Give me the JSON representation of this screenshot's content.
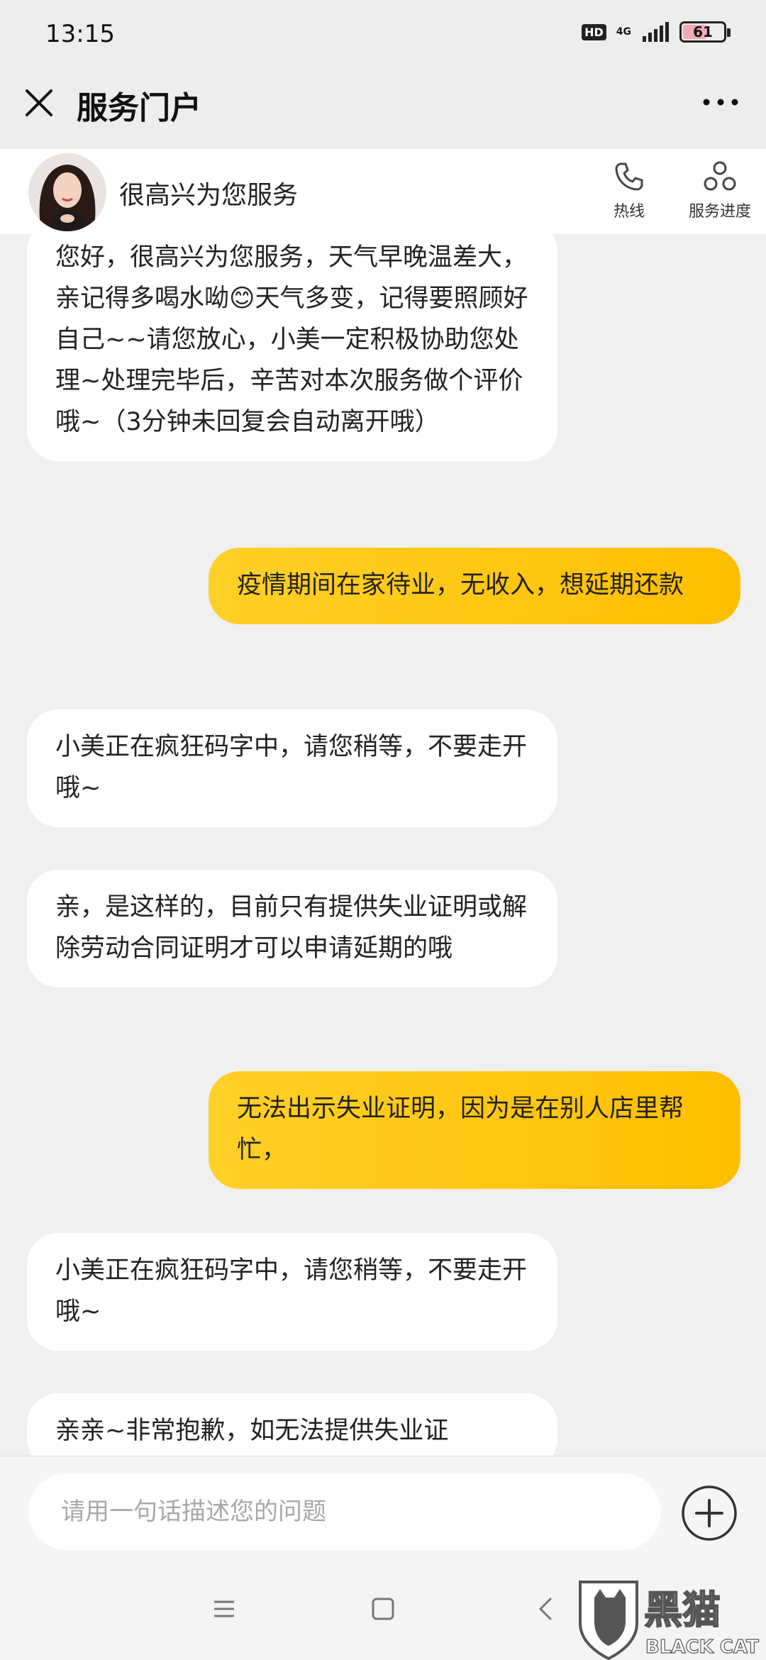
{
  "status_bar": {
    "time": "13:15",
    "hd_badge": "HD",
    "network": "4G",
    "battery": "61",
    "battery_level_percent": 61
  },
  "title_bar": {
    "title": "服务门户"
  },
  "service_header": {
    "greeting": "很高兴为您服务",
    "hotline_label": "热线",
    "progress_label": "服务进度"
  },
  "messages": [
    {
      "side": "left",
      "text": "您好，很高兴为您服务，天气早晚温差大，亲记得多喝水呦😊天气多变，记得要照顾好自己~~请您放心，小美一定积极协助您处理~处理完毕后，辛苦对本次服务做个评价哦~（3分钟未回复会自动离开哦）"
    },
    {
      "side": "right",
      "text": "疫情期间在家待业，无收入，想延期还款"
    },
    {
      "side": "left",
      "text": "小美正在疯狂码字中，请您稍等，不要走开哦~"
    },
    {
      "side": "left",
      "text": "亲，是这样的，目前只有提供失业证明或解除劳动合同证明才可以申请延期的哦"
    },
    {
      "side": "right",
      "text": "无法出示失业证明，因为是在别人店里帮忙，"
    },
    {
      "side": "left",
      "text": "小美正在疯狂码字中，请您稍等，不要走开哦~"
    },
    {
      "side": "left",
      "text": "亲亲~非常抱歉，如无法提供失业证"
    }
  ],
  "input": {
    "placeholder": "请用一句话描述您的问题"
  },
  "watermark": {
    "cn": "黑猫",
    "en": "BLACK CAT"
  },
  "colors": {
    "user_bubble": "#ffc61a",
    "agent_bubble": "#ffffff",
    "background": "#f0f0f0"
  }
}
